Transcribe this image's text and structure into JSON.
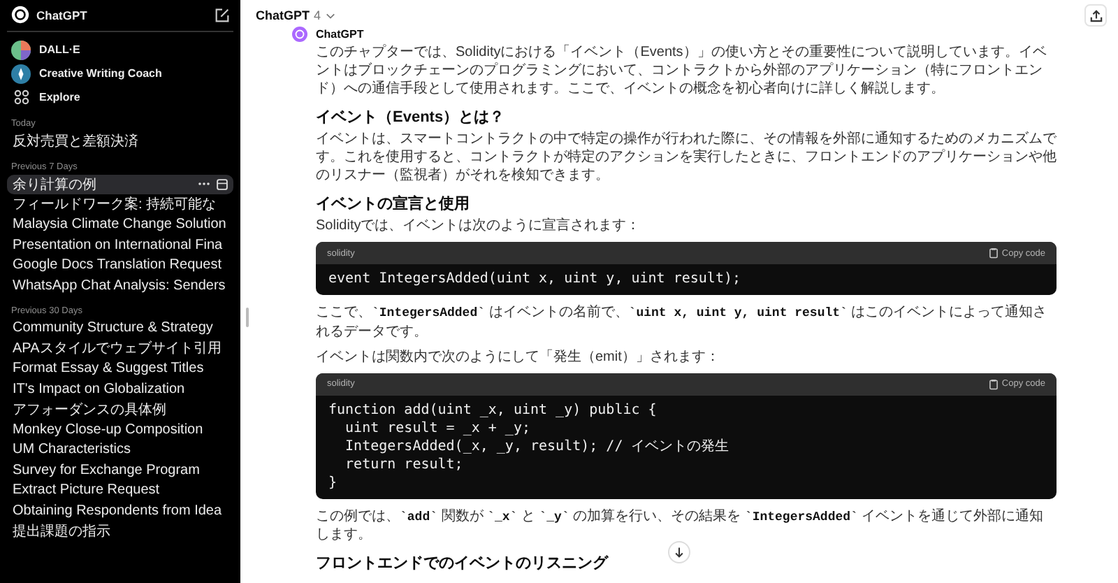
{
  "sidebar": {
    "brand": "ChatGPT",
    "gpts": [
      {
        "name": "DALL·E",
        "kind": "dalle"
      },
      {
        "name": "Creative Writing Coach",
        "kind": "coach"
      },
      {
        "name": "Explore",
        "kind": "explore"
      }
    ],
    "sections": [
      {
        "heading": "Today",
        "items": [
          {
            "label": "反対売買と差額決済",
            "selected": false
          }
        ]
      },
      {
        "heading": "Previous 7 Days",
        "items": [
          {
            "label": "余り計算の例",
            "selected": true
          },
          {
            "label": "フィールドワーク案: 持続可能な",
            "selected": false
          },
          {
            "label": "Malaysia Climate Change Solution",
            "selected": false
          },
          {
            "label": "Presentation on International Fina",
            "selected": false
          },
          {
            "label": "Google Docs Translation Request",
            "selected": false
          },
          {
            "label": "WhatsApp Chat Analysis: Senders",
            "selected": false
          }
        ]
      },
      {
        "heading": "Previous 30 Days",
        "items": [
          {
            "label": "Community Structure & Strategy",
            "selected": false
          },
          {
            "label": "APAスタイルでウェブサイト引用",
            "selected": false
          },
          {
            "label": "Format Essay & Suggest Titles",
            "selected": false
          },
          {
            "label": "IT's Impact on Globalization",
            "selected": false
          },
          {
            "label": "アフォーダンスの具体例",
            "selected": false
          },
          {
            "label": "Monkey Close-up Composition",
            "selected": false
          },
          {
            "label": "UM Characteristics",
            "selected": false
          },
          {
            "label": "Survey for Exchange Program",
            "selected": false
          },
          {
            "label": "Extract Picture Request",
            "selected": false
          },
          {
            "label": "Obtaining Respondents from Idea",
            "selected": false
          },
          {
            "label": "提出課題の指示",
            "selected": false
          }
        ]
      }
    ]
  },
  "header": {
    "model": "ChatGPT",
    "version": "4"
  },
  "message": {
    "author": "ChatGPT",
    "blocks": [
      {
        "kind": "p",
        "text": "このチャプターでは、Solidityにおける「イベント（Events）」の使い方とその重要性について説明しています。イベントはブロックチェーンのプログラミングにおいて、コントラクトから外部のアプリケーション（特にフロントエンド）への通信手段として使用されます。ここで、イベントの概念を初心者向けに詳しく解説します。"
      },
      {
        "kind": "h",
        "text": "イベント（Events）とは？"
      },
      {
        "kind": "p",
        "text": "イベントは、スマートコントラクトの中で特定の操作が行われた際に、その情報を外部に通知するためのメカニズムです。これを使用すると、コントラクトが特定のアクションを実行したときに、フロントエンドのアプリケーションや他のリスナー（監視者）がそれを検知できます。"
      },
      {
        "kind": "h",
        "text": "イベントの宣言と使用"
      },
      {
        "kind": "p",
        "text": "Solidityでは、イベントは次のように宣言されます："
      },
      {
        "kind": "code",
        "lang": "solidity",
        "copy": "Copy code",
        "lines": [
          "event IntegersAdded(uint x, uint y, uint result);"
        ]
      },
      {
        "kind": "p",
        "text": "ここで、**`IntegersAdded`** はイベントの名前で、**`uint x, uint y, uint result`** はこのイベントによって通知されるデータです。"
      },
      {
        "kind": "p",
        "text": "イベントは関数内で次のようにして「発生（emit）」されます："
      },
      {
        "kind": "code",
        "lang": "solidity",
        "copy": "Copy code",
        "lines": [
          "function add(uint _x, uint _y) public {",
          "  uint result = _x + _y;",
          "  IntegersAdded(_x, _y, result); // イベントの発生",
          "  return result;",
          "}"
        ]
      },
      {
        "kind": "p",
        "text": "この例では、**`add`** 関数が **`_x`** と **`_y`** の加算を行い、その結果を **`IntegersAdded`** イベントを通じて外部に通知します。"
      },
      {
        "kind": "h",
        "text": "フロントエンドでのイベントのリスニング"
      }
    ]
  }
}
